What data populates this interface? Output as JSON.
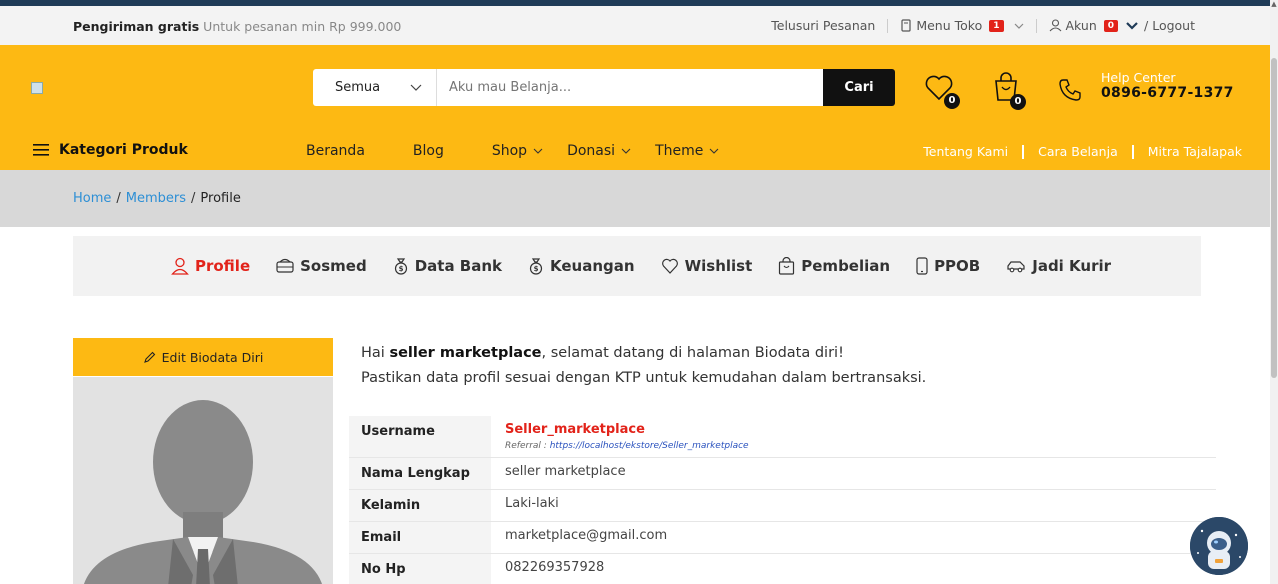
{
  "topbar": {
    "promo_bold": "Pengiriman gratis",
    "promo_text": "Untuk pesanan min Rp 999.000",
    "track_order": "Telusuri Pesanan",
    "store_menu": "Menu Toko",
    "store_badge": "1",
    "account": "Akun",
    "account_badge": "0",
    "logout": "/ Logout"
  },
  "header": {
    "search_category": "Semua",
    "search_placeholder": "Aku mau Belanja...",
    "search_button": "Cari",
    "wishlist_count": "0",
    "cart_count": "0",
    "help_title": "Help Center",
    "help_phone": "0896-6777-1377"
  },
  "nav": {
    "category_label": "Kategori Produk",
    "home": "Beranda",
    "blog": "Blog",
    "shop": "Shop",
    "donation": "Donasi",
    "theme": "Theme",
    "about": "Tentang Kami",
    "how_to_shop": "Cara Belanja",
    "partner": "Mitra Tajalapak"
  },
  "breadcrumb": {
    "home": "Home",
    "members": "Members",
    "current": "Profile"
  },
  "tabs": [
    "Profile",
    "Sosmed",
    "Data Bank",
    "Keuangan",
    "Wishlist",
    "Pembelian",
    "PPOB",
    "Jadi Kurir"
  ],
  "profile": {
    "edit_button": "Edit Biodata Diri",
    "greeting_prefix": "Hai",
    "greeting_name": "seller marketplace",
    "greeting_suffix": ", selamat datang di halaman Biodata diri!",
    "subtitle": "Pastikan data profil sesuai dengan KTP untuk kemudahan dalam bertransaksi.",
    "labels": {
      "username": "Username",
      "full_name": "Nama Lengkap",
      "gender": "Kelamin",
      "email": "Email",
      "phone": "No Hp"
    },
    "username": "Seller_marketplace",
    "referral_label": "Referral :",
    "referral_link": "https://localhost/ekstore/Seller_marketplace",
    "full_name": "seller marketplace",
    "gender": "Laki-laki",
    "email": "marketplace@gmail.com",
    "phone": "082269357928"
  },
  "colors": {
    "brand_yellow": "#fdb913",
    "accent_red": "#e2231a",
    "link_blue": "#2d8fd5"
  }
}
